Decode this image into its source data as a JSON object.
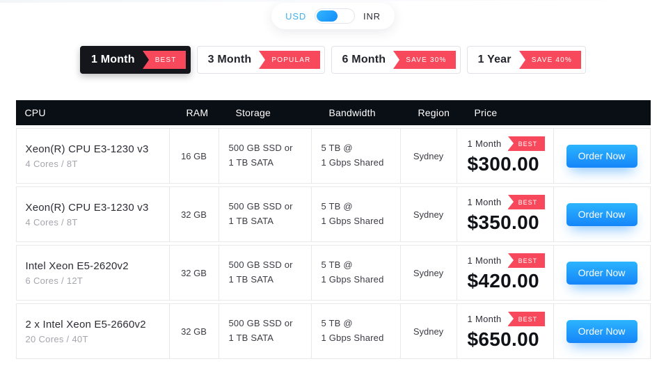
{
  "currency_toggle": {
    "left_label": "USD",
    "right_label": "INR",
    "selected": "USD"
  },
  "plan_tabs": [
    {
      "label": "1 Month",
      "badge": "BEST",
      "active": true
    },
    {
      "label": "3 Month",
      "badge": "POPULAR",
      "active": false
    },
    {
      "label": "6 Month",
      "badge": "SAVE 30%",
      "active": false
    },
    {
      "label": "1 Year",
      "badge": "SAVE 40%",
      "active": false
    }
  ],
  "table": {
    "columns": [
      "CPU",
      "RAM",
      "Storage",
      "Bandwidth",
      "Region",
      "Price",
      ""
    ],
    "rows": [
      {
        "cpu": "Xeon(R) CPU E3-1230 v3",
        "cores": "4 Cores / 8T",
        "ram": "16 GB",
        "storage_line1": "500 GB SSD or",
        "storage_line2": "1 TB SATA",
        "bandwidth_line1": "5 TB @",
        "bandwidth_line2": "1 Gbps Shared",
        "region": "Sydney",
        "term": "1 Month",
        "badge": "BEST",
        "price": "$300.00",
        "order_label": "Order Now"
      },
      {
        "cpu": "Xeon(R) CPU E3-1230 v3",
        "cores": "4 Cores / 8T",
        "ram": "32 GB",
        "storage_line1": "500 GB SSD or",
        "storage_line2": "1 TB SATA",
        "bandwidth_line1": "5 TB @",
        "bandwidth_line2": "1 Gbps Shared",
        "region": "Sydney",
        "term": "1 Month",
        "badge": "BEST",
        "price": "$350.00",
        "order_label": "Order Now"
      },
      {
        "cpu": "Intel Xeon E5-2620v2",
        "cores": "6 Cores / 12T",
        "ram": "32 GB",
        "storage_line1": "500 GB SSD or",
        "storage_line2": "1 TB SATA",
        "bandwidth_line1": "5 TB @",
        "bandwidth_line2": "1 Gbps Shared",
        "region": "Sydney",
        "term": "1 Month",
        "badge": "BEST",
        "price": "$420.00",
        "order_label": "Order Now"
      },
      {
        "cpu": "2 x Intel Xeon E5-2660v2",
        "cores": "20 Cores / 40T",
        "ram": "32 GB",
        "storage_line1": "500 GB SSD or",
        "storage_line2": "1 TB SATA",
        "bandwidth_line1": "5 TB @",
        "bandwidth_line2": "1 Gbps Shared",
        "region": "Sydney",
        "term": "1 Month",
        "badge": "BEST",
        "price": "$650.00",
        "order_label": "Order Now"
      }
    ]
  },
  "colors": {
    "accent_red": "#f8495c",
    "button_blue_top": "#2cb4fd",
    "button_blue_bottom": "#1585f9",
    "header_bg": "#0a0e15",
    "active_tab_bg": "#15161b",
    "usd_active_blue": "#3fb0f2"
  }
}
